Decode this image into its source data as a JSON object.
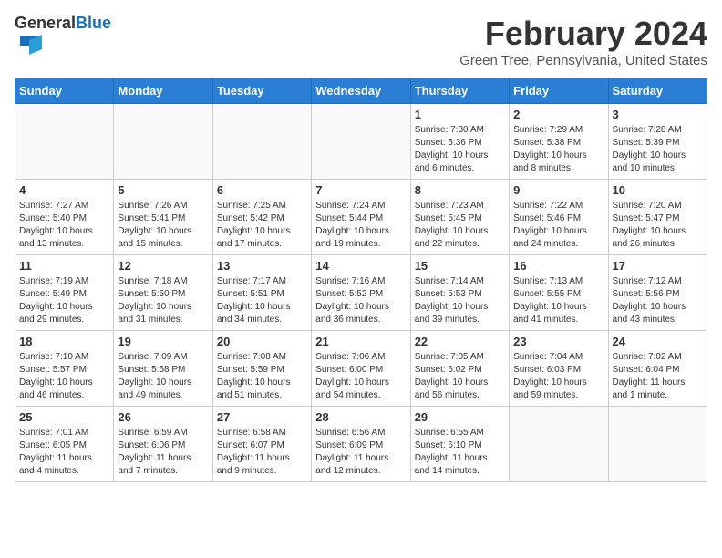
{
  "header": {
    "logo_general": "General",
    "logo_blue": "Blue",
    "month_title": "February 2024",
    "location": "Green Tree, Pennsylvania, United States"
  },
  "weekdays": [
    "Sunday",
    "Monday",
    "Tuesday",
    "Wednesday",
    "Thursday",
    "Friday",
    "Saturday"
  ],
  "weeks": [
    [
      {
        "day": "",
        "info": ""
      },
      {
        "day": "",
        "info": ""
      },
      {
        "day": "",
        "info": ""
      },
      {
        "day": "",
        "info": ""
      },
      {
        "day": "1",
        "info": "Sunrise: 7:30 AM\nSunset: 5:36 PM\nDaylight: 10 hours\nand 6 minutes."
      },
      {
        "day": "2",
        "info": "Sunrise: 7:29 AM\nSunset: 5:38 PM\nDaylight: 10 hours\nand 8 minutes."
      },
      {
        "day": "3",
        "info": "Sunrise: 7:28 AM\nSunset: 5:39 PM\nDaylight: 10 hours\nand 10 minutes."
      }
    ],
    [
      {
        "day": "4",
        "info": "Sunrise: 7:27 AM\nSunset: 5:40 PM\nDaylight: 10 hours\nand 13 minutes."
      },
      {
        "day": "5",
        "info": "Sunrise: 7:26 AM\nSunset: 5:41 PM\nDaylight: 10 hours\nand 15 minutes."
      },
      {
        "day": "6",
        "info": "Sunrise: 7:25 AM\nSunset: 5:42 PM\nDaylight: 10 hours\nand 17 minutes."
      },
      {
        "day": "7",
        "info": "Sunrise: 7:24 AM\nSunset: 5:44 PM\nDaylight: 10 hours\nand 19 minutes."
      },
      {
        "day": "8",
        "info": "Sunrise: 7:23 AM\nSunset: 5:45 PM\nDaylight: 10 hours\nand 22 minutes."
      },
      {
        "day": "9",
        "info": "Sunrise: 7:22 AM\nSunset: 5:46 PM\nDaylight: 10 hours\nand 24 minutes."
      },
      {
        "day": "10",
        "info": "Sunrise: 7:20 AM\nSunset: 5:47 PM\nDaylight: 10 hours\nand 26 minutes."
      }
    ],
    [
      {
        "day": "11",
        "info": "Sunrise: 7:19 AM\nSunset: 5:49 PM\nDaylight: 10 hours\nand 29 minutes."
      },
      {
        "day": "12",
        "info": "Sunrise: 7:18 AM\nSunset: 5:50 PM\nDaylight: 10 hours\nand 31 minutes."
      },
      {
        "day": "13",
        "info": "Sunrise: 7:17 AM\nSunset: 5:51 PM\nDaylight: 10 hours\nand 34 minutes."
      },
      {
        "day": "14",
        "info": "Sunrise: 7:16 AM\nSunset: 5:52 PM\nDaylight: 10 hours\nand 36 minutes."
      },
      {
        "day": "15",
        "info": "Sunrise: 7:14 AM\nSunset: 5:53 PM\nDaylight: 10 hours\nand 39 minutes."
      },
      {
        "day": "16",
        "info": "Sunrise: 7:13 AM\nSunset: 5:55 PM\nDaylight: 10 hours\nand 41 minutes."
      },
      {
        "day": "17",
        "info": "Sunrise: 7:12 AM\nSunset: 5:56 PM\nDaylight: 10 hours\nand 43 minutes."
      }
    ],
    [
      {
        "day": "18",
        "info": "Sunrise: 7:10 AM\nSunset: 5:57 PM\nDaylight: 10 hours\nand 46 minutes."
      },
      {
        "day": "19",
        "info": "Sunrise: 7:09 AM\nSunset: 5:58 PM\nDaylight: 10 hours\nand 49 minutes."
      },
      {
        "day": "20",
        "info": "Sunrise: 7:08 AM\nSunset: 5:59 PM\nDaylight: 10 hours\nand 51 minutes."
      },
      {
        "day": "21",
        "info": "Sunrise: 7:06 AM\nSunset: 6:00 PM\nDaylight: 10 hours\nand 54 minutes."
      },
      {
        "day": "22",
        "info": "Sunrise: 7:05 AM\nSunset: 6:02 PM\nDaylight: 10 hours\nand 56 minutes."
      },
      {
        "day": "23",
        "info": "Sunrise: 7:04 AM\nSunset: 6:03 PM\nDaylight: 10 hours\nand 59 minutes."
      },
      {
        "day": "24",
        "info": "Sunrise: 7:02 AM\nSunset: 6:04 PM\nDaylight: 11 hours\nand 1 minute."
      }
    ],
    [
      {
        "day": "25",
        "info": "Sunrise: 7:01 AM\nSunset: 6:05 PM\nDaylight: 11 hours\nand 4 minutes."
      },
      {
        "day": "26",
        "info": "Sunrise: 6:59 AM\nSunset: 6:06 PM\nDaylight: 11 hours\nand 7 minutes."
      },
      {
        "day": "27",
        "info": "Sunrise: 6:58 AM\nSunset: 6:07 PM\nDaylight: 11 hours\nand 9 minutes."
      },
      {
        "day": "28",
        "info": "Sunrise: 6:56 AM\nSunset: 6:09 PM\nDaylight: 11 hours\nand 12 minutes."
      },
      {
        "day": "29",
        "info": "Sunrise: 6:55 AM\nSunset: 6:10 PM\nDaylight: 11 hours\nand 14 minutes."
      },
      {
        "day": "",
        "info": ""
      },
      {
        "day": "",
        "info": ""
      }
    ]
  ]
}
